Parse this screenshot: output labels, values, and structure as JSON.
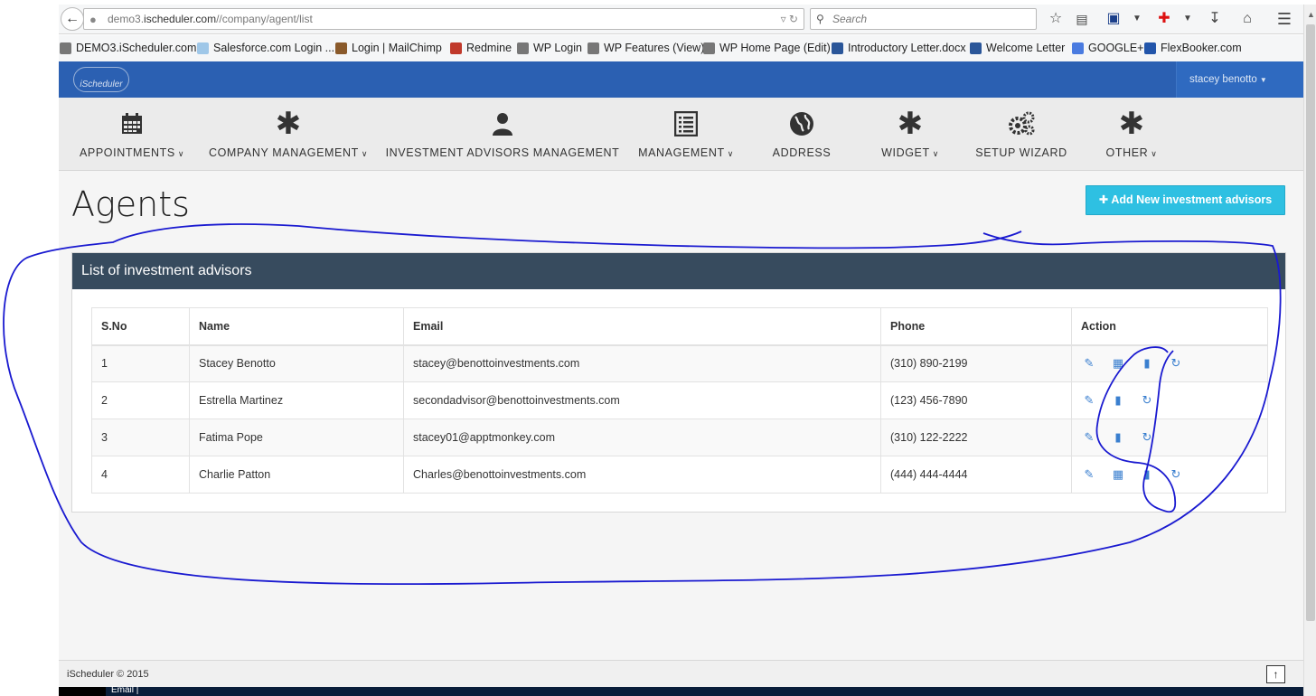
{
  "browser": {
    "url_host": "demo3.",
    "url_domain": "ischeduler.com",
    "url_path": "//company/agent/list",
    "search_placeholder": "Search"
  },
  "bookmarks": [
    {
      "label": "DEMO3.iScheduler.com",
      "icon": "clock-icon",
      "color": "#777777"
    },
    {
      "label": "Salesforce.com Login ...",
      "icon": "cloud-icon",
      "color": "#9fc7e8"
    },
    {
      "label": "Login | MailChimp",
      "icon": "chimp-icon",
      "color": "#8a5a2b"
    },
    {
      "label": "Redmine",
      "icon": "redmine-icon",
      "color": "#c0392b"
    },
    {
      "label": "WP Login",
      "icon": "clock-icon",
      "color": "#777777"
    },
    {
      "label": "WP Features (View)",
      "icon": "clock-icon",
      "color": "#777777"
    },
    {
      "label": "WP Home Page (Edit)",
      "icon": "clock-icon",
      "color": "#777777"
    },
    {
      "label": "Introductory Letter.docx",
      "icon": "word-icon",
      "color": "#2a5699"
    },
    {
      "label": "Welcome Letter",
      "icon": "word-icon",
      "color": "#2a5699"
    },
    {
      "label": "GOOGLE+",
      "icon": "google-icon",
      "color": "#4a7be0"
    },
    {
      "label": "FlexBooker.com",
      "icon": "fb-icon",
      "color": "#2255aa"
    }
  ],
  "app": {
    "user_name": "stacey benotto"
  },
  "menu": [
    {
      "label": "APPOINTMENTS",
      "icon": "calendar-icon",
      "dropdown": true
    },
    {
      "label": "COMPANY MANAGEMENT",
      "icon": "asterisk-icon",
      "dropdown": true
    },
    {
      "label": "INVESTMENT ADVISORS MANAGEMENT",
      "icon": "user-icon",
      "dropdown": false
    },
    {
      "label": "MANAGEMENT",
      "icon": "list-icon",
      "dropdown": true
    },
    {
      "label": "ADDRESS",
      "icon": "globe-icon",
      "dropdown": false
    },
    {
      "label": "WIDGET",
      "icon": "asterisk-icon",
      "dropdown": true
    },
    {
      "label": "SETUP WIZARD",
      "icon": "gears-icon",
      "dropdown": false
    },
    {
      "label": "OTHER",
      "icon": "asterisk-icon",
      "dropdown": true
    }
  ],
  "page": {
    "title": "Agents",
    "add_button": "Add New investment advisors",
    "panel_title": "List of investment advisors"
  },
  "table": {
    "headers": [
      "S.No",
      "Name",
      "Email",
      "Phone",
      "Action"
    ],
    "rows": [
      {
        "sno": "1",
        "name": "Stacey Benotto",
        "email": "stacey@benottoinvestments.com",
        "phone": "(310) 890-2199",
        "actions": [
          "edit-icon",
          "calendar-icon",
          "trash-icon",
          "refresh-icon"
        ]
      },
      {
        "sno": "2",
        "name": "Estrella Martinez",
        "email": "secondadvisor@benottoinvestments.com",
        "phone": "(123) 456-7890",
        "actions": [
          "edit-icon",
          "trash-icon",
          "refresh-icon"
        ]
      },
      {
        "sno": "3",
        "name": "Fatima Pope",
        "email": "stacey01@apptmonkey.com",
        "phone": "(310) 122-2222",
        "actions": [
          "edit-icon",
          "trash-icon",
          "refresh-icon"
        ]
      },
      {
        "sno": "4",
        "name": "Charlie Patton",
        "email": "Charles@benottoinvestments.com",
        "phone": "(444) 444-4444",
        "actions": [
          "edit-icon",
          "calendar-icon",
          "trash-icon",
          "refresh-icon"
        ]
      }
    ]
  },
  "footer": {
    "copyright": "iScheduler © 2015"
  },
  "taskbar": {
    "item": "Email |"
  },
  "colors": {
    "navbar": "#2b60b2",
    "panel_heading": "#374b5e",
    "add_button": "#2ec0e2",
    "action_icon": "#3a7fcf",
    "annotation_ink": "#1a1ad0"
  }
}
